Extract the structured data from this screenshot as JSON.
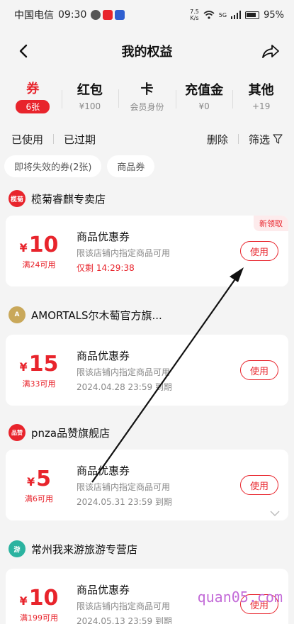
{
  "status_bar": {
    "carrier": "中国电信",
    "time": "09:30",
    "net_speed_value": "7.5",
    "net_speed_unit": "K/s",
    "signal_label": "5G",
    "battery": "95%"
  },
  "header": {
    "title": "我的权益",
    "back_icon": "back-arrow-icon",
    "share_icon": "share-icon"
  },
  "category_tabs": [
    {
      "label": "券",
      "sub": "6张",
      "active": true
    },
    {
      "label": "红包",
      "sub": "¥100"
    },
    {
      "label": "卡",
      "sub": "会员身份"
    },
    {
      "label": "充值金",
      "sub": "¥0"
    },
    {
      "label": "其他",
      "sub": "+19"
    }
  ],
  "filter_bar": {
    "used": "已使用",
    "expired": "已过期",
    "delete": "删除",
    "filter": "筛选"
  },
  "chips": [
    "即将失效的券(2张)",
    "商品券"
  ],
  "stores": [
    {
      "name": "榄菊睿麒专卖店",
      "logo_text": "榄菊",
      "logo_color": "#e8242c",
      "coupon": {
        "currency": "¥",
        "amount": "10",
        "condition": "满24可用",
        "title": "商品优惠券",
        "desc": "限该店铺内指定商品可用",
        "time": "仅剩 14:29:38",
        "time_red": true,
        "tag": "新领取",
        "button": "使用"
      }
    },
    {
      "name": "AMORTALS尔木萄官方旗...",
      "logo_text": "A",
      "logo_color": "#c9a85a",
      "coupon": {
        "currency": "¥",
        "amount": "15",
        "condition": "满33可用",
        "title": "商品优惠券",
        "desc": "限该店铺内指定商品可用",
        "time": "2024.04.28 23:59 到期",
        "button": "使用"
      }
    },
    {
      "name": "pnza品赞旗舰店",
      "logo_text": "品赞",
      "logo_color": "#e8242c",
      "coupon": {
        "currency": "¥",
        "amount": "5",
        "condition": "满6可用",
        "title": "商品优惠券",
        "desc": "限该店铺内指定商品可用",
        "time": "2024.05.31 23:59 到期",
        "button": "使用"
      }
    },
    {
      "name": "常州我来游旅游专营店",
      "logo_text": "游",
      "logo_color": "#2bb3a0",
      "coupon": {
        "currency": "¥",
        "amount": "10",
        "condition": "满199可用",
        "title": "商品优惠券",
        "desc": "限该店铺内指定商品可用",
        "time": "2024.05.13 23:59 到期",
        "button": "使用"
      }
    }
  ],
  "watermark": "quan05.com",
  "colors": {
    "accent": "#e8242c",
    "background": "#f4f4f4"
  }
}
